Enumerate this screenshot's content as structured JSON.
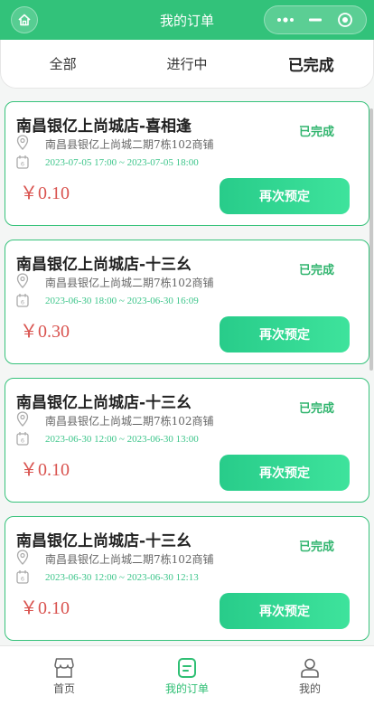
{
  "header": {
    "title": "我的订单",
    "home_icon": "home-icon",
    "capsule_icons": [
      "more-icon",
      "minimize-icon",
      "close-target-icon"
    ]
  },
  "tabs": [
    {
      "label": "全部",
      "active": false
    },
    {
      "label": "进行中",
      "active": false
    },
    {
      "label": "已完成",
      "active": true
    }
  ],
  "orders": [
    {
      "title": "南昌银亿上尚城店-喜相逢",
      "status": "已完成",
      "address": "南昌县银亿上尚城二期7栋102商铺",
      "time": "2023-07-05 17:00 ~ 2023-07-05 18:00",
      "price": "￥0.10",
      "action": "再次预定"
    },
    {
      "title": "南昌银亿上尚城店-十三幺",
      "status": "已完成",
      "address": "南昌县银亿上尚城二期7栋102商铺",
      "time": "2023-06-30 18:00 ~ 2023-06-30 16:09",
      "price": "￥0.30",
      "action": "再次预定"
    },
    {
      "title": "南昌银亿上尚城店-十三幺",
      "status": "已完成",
      "address": "南昌县银亿上尚城二期7栋102商铺",
      "time": "2023-06-30 12:00 ~ 2023-06-30 13:00",
      "price": "￥0.10",
      "action": "再次预定"
    },
    {
      "title": "南昌银亿上尚城店-十三幺",
      "status": "已完成",
      "address": "南昌县银亿上尚城二期7栋102商铺",
      "time": "2023-06-30 12:00 ~ 2023-06-30 12:13",
      "price": "￥0.10",
      "action": "再次预定"
    }
  ],
  "tabbar": [
    {
      "label": "首页",
      "icon": "store-icon",
      "active": false
    },
    {
      "label": "我的订单",
      "icon": "order-document-icon",
      "active": true
    },
    {
      "label": "我的",
      "icon": "user-icon",
      "active": false
    }
  ],
  "colors": {
    "brand_green": "#32c27a",
    "status_green": "#32b56f",
    "price_red": "#d9534f",
    "time_green": "#3cc58a"
  }
}
